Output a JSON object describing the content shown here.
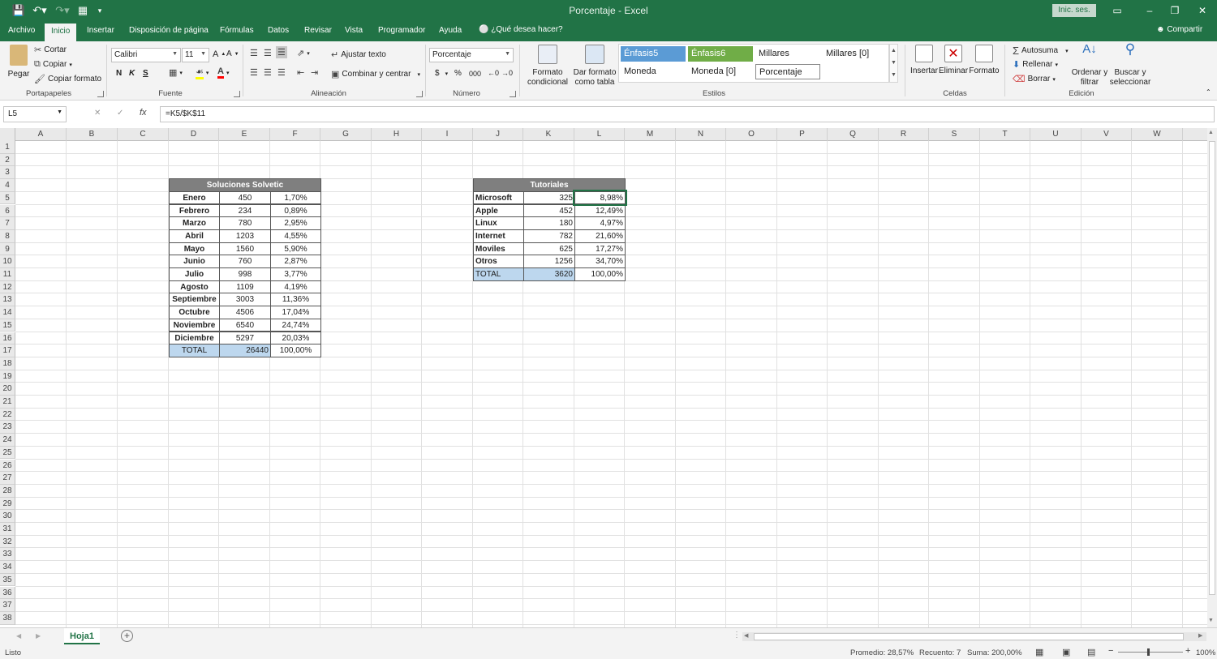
{
  "window": {
    "title": "Porcentaje  -  Excel",
    "signin": "Inic. ses.",
    "controls": [
      "–",
      "❐",
      "✕",
      "▭"
    ]
  },
  "tabs": [
    "Archivo",
    "Inicio",
    "Insertar",
    "Disposición de página",
    "Fórmulas",
    "Datos",
    "Revisar",
    "Vista",
    "Programador",
    "Ayuda"
  ],
  "tellme": "¿Qué desea hacer?",
  "share": "Compartir",
  "ribbon": {
    "clipboard": {
      "label": "Portapapeles",
      "paste": "Pegar",
      "cut": "Cortar",
      "copy": "Copiar",
      "format_painter": "Copiar formato"
    },
    "font": {
      "label": "Fuente",
      "name": "Calibri",
      "size": "11",
      "bold": "N",
      "italic": "K",
      "underline": "S"
    },
    "alignment": {
      "label": "Alineación",
      "wrap": "Ajustar texto",
      "merge": "Combinar y centrar"
    },
    "number": {
      "label": "Número",
      "format": "Porcentaje",
      "currency": "$",
      "percent": "%",
      "comma": "000"
    },
    "styles": {
      "label": "Estilos",
      "conditional": "Formato condicional",
      "as_table": "Dar formato como tabla",
      "cells": [
        "Énfasis5",
        "Énfasis6",
        "Millares",
        "Millares [0]",
        "Moneda",
        "Moneda [0]",
        "Porcentaje"
      ],
      "accent5_color": "#5b9bd5",
      "accent6_color": "#70ad47"
    },
    "cells": {
      "label": "Celdas",
      "insert": "Insertar",
      "delete": "Eliminar",
      "format": "Formato"
    },
    "editing": {
      "label": "Edición",
      "autosum": "Autosuma",
      "fill": "Rellenar",
      "clear": "Borrar",
      "sort": "Ordenar y filtrar",
      "find": "Buscar y seleccionar"
    }
  },
  "formula_bar": {
    "name_box": "L5",
    "fx": "fx",
    "formula": "=K5/$K$11"
  },
  "columns": [
    "A",
    "B",
    "C",
    "D",
    "E",
    "F",
    "G",
    "H",
    "I",
    "J",
    "K",
    "L",
    "M",
    "N",
    "O",
    "P",
    "Q",
    "R",
    "S",
    "T",
    "U",
    "V",
    "W"
  ],
  "row_count": 38,
  "table1": {
    "header": "Soluciones Solvetic",
    "rows": [
      [
        "Enero",
        "450",
        "1,70%"
      ],
      [
        "Febrero",
        "234",
        "0,89%"
      ],
      [
        "Marzo",
        "780",
        "2,95%"
      ],
      [
        "Abril",
        "1203",
        "4,55%"
      ],
      [
        "Mayo",
        "1560",
        "5,90%"
      ],
      [
        "Junio",
        "760",
        "2,87%"
      ],
      [
        "Julio",
        "998",
        "3,77%"
      ],
      [
        "Agosto",
        "1109",
        "4,19%"
      ],
      [
        "Septiembre",
        "3003",
        "11,36%"
      ],
      [
        "Octubre",
        "4506",
        "17,04%"
      ],
      [
        "Noviembre",
        "6540",
        "24,74%"
      ],
      [
        "Diciembre",
        "5297",
        "20,03%"
      ]
    ],
    "total": [
      "TOTAL",
      "26440",
      "100,00%"
    ]
  },
  "table2": {
    "header": "Tutoriales",
    "rows": [
      [
        "Microsoft",
        "325",
        "8,98%"
      ],
      [
        "Apple",
        "452",
        "12,49%"
      ],
      [
        "Linux",
        "180",
        "4,97%"
      ],
      [
        "Internet",
        "782",
        "21,60%"
      ],
      [
        "Moviles",
        "625",
        "17,27%"
      ],
      [
        "Otros",
        "1256",
        "34,70%"
      ]
    ],
    "total": [
      "TOTAL",
      "3620",
      "100,00%"
    ]
  },
  "sheet_tab": "Hoja1",
  "status": {
    "mode": "Listo",
    "average": "Promedio: 28,57%",
    "count": "Recuento: 7",
    "sum": "Suma: 200,00%",
    "zoom": "100%"
  }
}
